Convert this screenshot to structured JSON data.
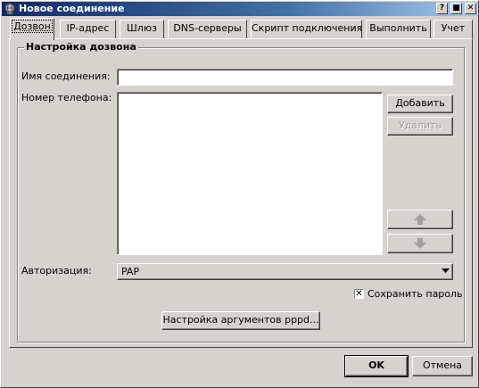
{
  "window": {
    "title": "Новое соединение",
    "controls": [
      "?",
      "■",
      "✕"
    ]
  },
  "tabs": [
    {
      "label": "Дозвон",
      "active": true
    },
    {
      "label": "IP-адрес",
      "active": false
    },
    {
      "label": "Шлюз",
      "active": false
    },
    {
      "label": "DNS-серверы",
      "active": false
    },
    {
      "label": "Скрипт подключения",
      "active": false
    },
    {
      "label": "Выполнить",
      "active": false
    },
    {
      "label": "Учет",
      "active": false
    }
  ],
  "dial": {
    "group_title": "Настройка дозвона",
    "connection_name_label": "Имя соединения:",
    "connection_name_value": "",
    "phone_label": "Номер телефона:",
    "add_button": "Добавить",
    "remove_button": "Удалить",
    "auth_label": "Авторизация:",
    "auth_value": "PAP",
    "save_password_label": "Сохранить пароль",
    "save_password_checked": true,
    "save_password_mark": "✕",
    "pppd_args_button": "Настройка аргументов pppd..."
  },
  "footer": {
    "ok_label": "OK",
    "cancel_label": "Отмена"
  }
}
